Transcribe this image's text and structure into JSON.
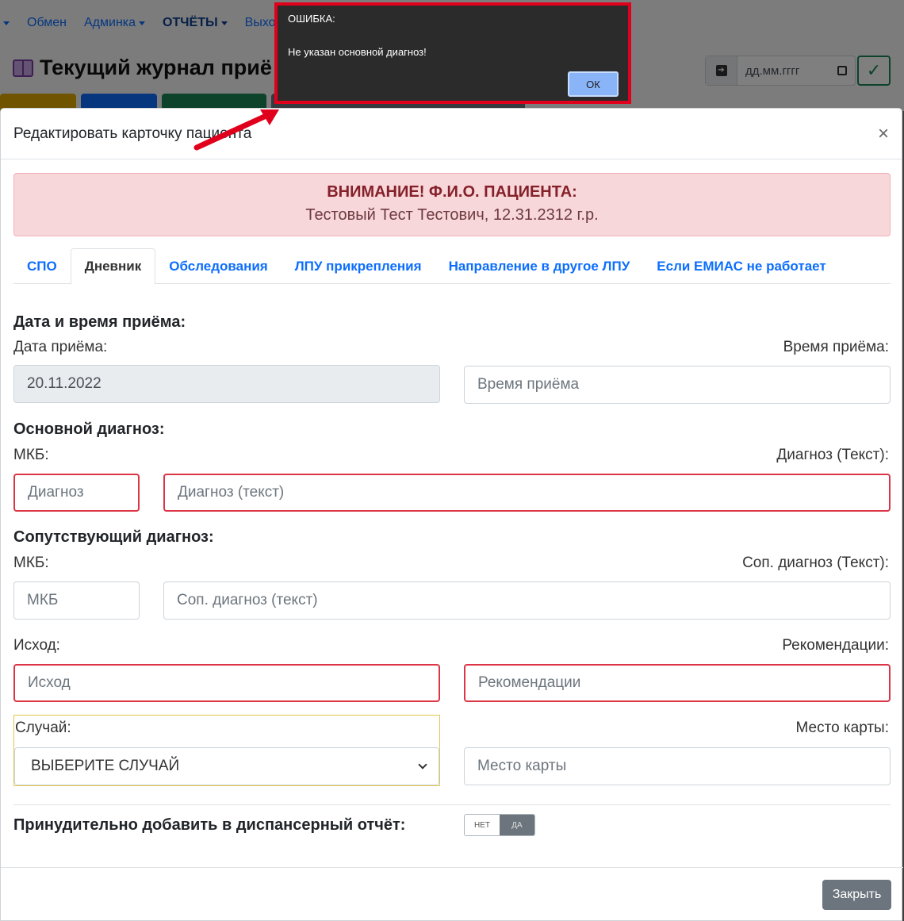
{
  "background": {
    "nav": [
      {
        "label": "Обмен",
        "caret": false
      },
      {
        "label": "Админка",
        "caret": true
      },
      {
        "label": "ОТЧЁТЫ",
        "caret": true
      },
      {
        "label": "Выход",
        "caret": false
      }
    ],
    "title": "Текущий журнал приё",
    "date_placeholder": "дд.мм.гггг",
    "button_colors": [
      "#e0a800",
      "#0d6efd",
      "#198754",
      "#6c757d"
    ]
  },
  "modal": {
    "title": "Редактировать карточку пациента",
    "close_symbol": "×",
    "alert": {
      "title": "ВНИМАНИЕ! Ф.И.О. ПАЦИЕНТА:",
      "patient": "Тестовый Тест Тестович, 12.31.2312 г.р."
    },
    "tabs": [
      {
        "label": "СПО",
        "active": false
      },
      {
        "label": "Дневник",
        "active": true
      },
      {
        "label": "Обследования",
        "active": false
      },
      {
        "label": "ЛПУ прикрепления",
        "active": false
      },
      {
        "label": "Направление в другое ЛПУ",
        "active": false
      },
      {
        "label": "Если ЕМИАС не работает",
        "active": false
      }
    ],
    "datetime": {
      "section": "Дата и время приёма:",
      "date_label": "Дата приёма:",
      "date_value": "20.11.2022",
      "time_label": "Время приёма:",
      "time_placeholder": "Время приёма"
    },
    "main_diagnosis": {
      "section": "Основной диагноз:",
      "mkb_label": "МКБ:",
      "text_label": "Диагноз (Текст):",
      "mkb_placeholder": "Диагноз",
      "text_placeholder": "Диагноз (текст)"
    },
    "co_diagnosis": {
      "section": "Сопутствующий диагноз:",
      "mkb_label": "МКБ:",
      "text_label": "Соп. диагноз (Текст):",
      "mkb_placeholder": "МКБ",
      "text_placeholder": "Соп. диагноз (текст)"
    },
    "outcome": {
      "label": "Исход:",
      "placeholder": "Исход"
    },
    "recommendations": {
      "label": "Рекомендации:",
      "placeholder": "Рекомендации"
    },
    "case": {
      "label": "Случай:",
      "selected": "ВЫБЕРИТЕ СЛУЧАЙ"
    },
    "card_place": {
      "label": "Место карты:",
      "placeholder": "Место карты"
    },
    "dispensary": {
      "label": "Принудительно добавить в диспансерный отчёт:",
      "off": "НЕТ",
      "on": "ДА",
      "value": "ДА"
    },
    "close_button": "Закрыть"
  },
  "error_dialog": {
    "title": "ОШИБКА:",
    "message": "Не указан основной диагноз!",
    "ok": "ОК",
    "border_color": "#e0001b"
  }
}
